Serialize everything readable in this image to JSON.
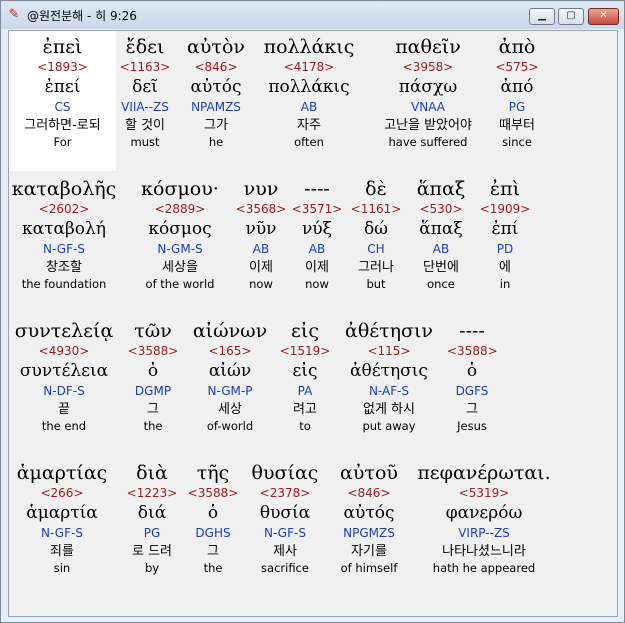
{
  "window": {
    "title": "@원전분해 - 히 9:26",
    "icons": {
      "app": "app-logo-icon",
      "minimize": "minimize-icon",
      "maximize": "maximize-icon",
      "close": "close-icon"
    },
    "button_glyphs": {
      "minimize": "▁",
      "maximize": "▢",
      "close": "✕"
    }
  },
  "rows": [
    {
      "words": [
        {
          "greek": "ἐπεὶ",
          "strong": "<1893>",
          "lexical": "ἐπεί",
          "parse": "CS",
          "korean": "그러하면-로되",
          "english": "For"
        },
        {
          "greek": "ἔδει",
          "strong": "<1163>",
          "lexical": "δεῖ",
          "parse": "VIIA--ZS",
          "korean": "할 것이",
          "english": "must"
        },
        {
          "greek": "αὐτὸν",
          "strong": "<846>",
          "lexical": "αὐτός",
          "parse": "NPAMZS",
          "korean": "그가",
          "english": "he"
        },
        {
          "greek": "πολλάκις",
          "strong": "<4178>",
          "lexical": "πολλάκις",
          "parse": "AB",
          "korean": "자주",
          "english": "often"
        },
        {
          "greek": "παθεῖν",
          "strong": "<3958>",
          "lexical": "πάσχω",
          "parse": "VNAA",
          "korean": "고난을 받았어야",
          "english": "have suffered"
        },
        {
          "greek": "ἀπὸ",
          "strong": "<575>",
          "lexical": "ἀπό",
          "parse": "PG",
          "korean": "때부터",
          "english": "since"
        }
      ]
    },
    {
      "words": [
        {
          "greek": "καταβολῆς",
          "strong": "<2602>",
          "lexical": "καταβολή",
          "parse": "N-GF-S",
          "korean": "창조할",
          "english": "the foundation"
        },
        {
          "greek": "κόσμου·",
          "strong": "<2889>",
          "lexical": "κόσμος",
          "parse": "N-GM-S",
          "korean": "세상을",
          "english": "of the world"
        },
        {
          "greek": "νυν",
          "strong": "<3568>",
          "lexical": "νῦν",
          "parse": "AB",
          "korean": "이제",
          "english": "now"
        },
        {
          "greek": "----",
          "strong": "<3571>",
          "lexical": "νύξ",
          "parse": "AB",
          "korean": "이제",
          "english": "now"
        },
        {
          "greek": "δὲ",
          "strong": "<1161>",
          "lexical": "δώ",
          "parse": "CH",
          "korean": "그러나",
          "english": "but"
        },
        {
          "greek": "ἅπαξ",
          "strong": "<530>",
          "lexical": "ἅπαξ",
          "parse": "AB",
          "korean": "단번에",
          "english": "once"
        },
        {
          "greek": "ἐπὶ",
          "strong": "<1909>",
          "lexical": "ἐπί",
          "parse": "PD",
          "korean": "에",
          "english": "in"
        }
      ]
    },
    {
      "words": [
        {
          "greek": "συντελείᾳ",
          "strong": "<4930>",
          "lexical": "συντέλεια",
          "parse": "N-DF-S",
          "korean": "끝",
          "english": "the end"
        },
        {
          "greek": "τῶν",
          "strong": "<3588>",
          "lexical": "ὁ",
          "parse": "DGMP",
          "korean": "그",
          "english": "the"
        },
        {
          "greek": "αἰώνων",
          "strong": "<165>",
          "lexical": "αἰών",
          "parse": "N-GM-P",
          "korean": "세상",
          "english": "of-world"
        },
        {
          "greek": "εἰς",
          "strong": "<1519>",
          "lexical": "εἰς",
          "parse": "PA",
          "korean": "려고",
          "english": "to"
        },
        {
          "greek": "ἀθέτησιν",
          "strong": "<115>",
          "lexical": "ἀθέτησις",
          "parse": "N-AF-S",
          "korean": "없게 하시",
          "english": "put away"
        },
        {
          "greek": "----",
          "strong": "<3588>",
          "lexical": "ὁ",
          "parse": "DGFS",
          "korean": "그",
          "english": "Jesus"
        }
      ]
    },
    {
      "words": [
        {
          "greek": "ἁμαρτίας",
          "strong": "<266>",
          "lexical": "ἁμαρτία",
          "parse": "N-GF-S",
          "korean": "죄를",
          "english": "sin"
        },
        {
          "greek": "διὰ",
          "strong": "<1223>",
          "lexical": "διά",
          "parse": "PG",
          "korean": "로 드려",
          "english": "by"
        },
        {
          "greek": "τῆς",
          "strong": "<3588>",
          "lexical": "ὁ",
          "parse": "DGHS",
          "korean": "그",
          "english": "the"
        },
        {
          "greek": "θυσίας",
          "strong": "<2378>",
          "lexical": "θυσία",
          "parse": "N-GF-S",
          "korean": "제사",
          "english": "sacrifice"
        },
        {
          "greek": "αὐτοῦ",
          "strong": "<846>",
          "lexical": "αὐτός",
          "parse": "NPGMZS",
          "korean": "자기를",
          "english": "of himself"
        },
        {
          "greek": "πεφανέρωται.",
          "strong": "<5319>",
          "lexical": "φανερόω",
          "parse": "VIRP--ZS",
          "korean": "나타나셨느니라",
          "english": "hath he appeared"
        }
      ]
    }
  ]
}
